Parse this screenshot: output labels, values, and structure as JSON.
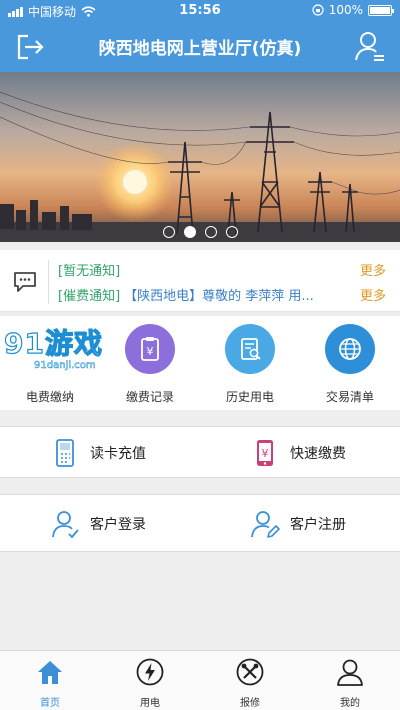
{
  "status_bar": {
    "carrier": "中国移动",
    "time": "15:56",
    "battery": "100%"
  },
  "header": {
    "title": "陕西地电网上营业厅(仿真)"
  },
  "banner": {
    "slide_count": 4,
    "active_slide": 2
  },
  "notices": [
    {
      "tag": "[暂无通知]",
      "text": "",
      "more": "更多"
    },
    {
      "tag": "[催费通知]",
      "text": "【陕西地电】尊敬的 李萍萍 用...",
      "more": "更多"
    }
  ],
  "watermark": {
    "big": "91游戏",
    "small": "91danji.com"
  },
  "quick_functions": [
    {
      "label": "电费缴纳",
      "icon": "payment-icon"
    },
    {
      "label": "缴费记录",
      "icon": "receipt-icon",
      "color": "#8c6fdb"
    },
    {
      "label": "历史用电",
      "icon": "history-doc-icon",
      "color": "#4aa8e4"
    },
    {
      "label": "交易清单",
      "icon": "globe-icon",
      "color": "#2d8fd8"
    }
  ],
  "actions_row1": [
    {
      "label": "读卡充值",
      "icon": "card-reader-icon"
    },
    {
      "label": "快速缴费",
      "icon": "phone-pay-icon"
    }
  ],
  "actions_row2": [
    {
      "label": "客户登录",
      "icon": "user-login-icon"
    },
    {
      "label": "客户注册",
      "icon": "user-register-icon"
    }
  ],
  "tabbar": [
    {
      "label": "首页",
      "icon": "home-icon",
      "active": true
    },
    {
      "label": "用电",
      "icon": "lightning-icon",
      "active": false
    },
    {
      "label": "报修",
      "icon": "tools-icon",
      "active": false
    },
    {
      "label": "我的",
      "icon": "profile-icon",
      "active": false
    }
  ],
  "colors": {
    "header": "#4a98dc",
    "notice_tag": "#32a36a",
    "notice_text": "#3a7fc8",
    "more": "#e09a26",
    "tab_active": "#3c8fd6"
  }
}
